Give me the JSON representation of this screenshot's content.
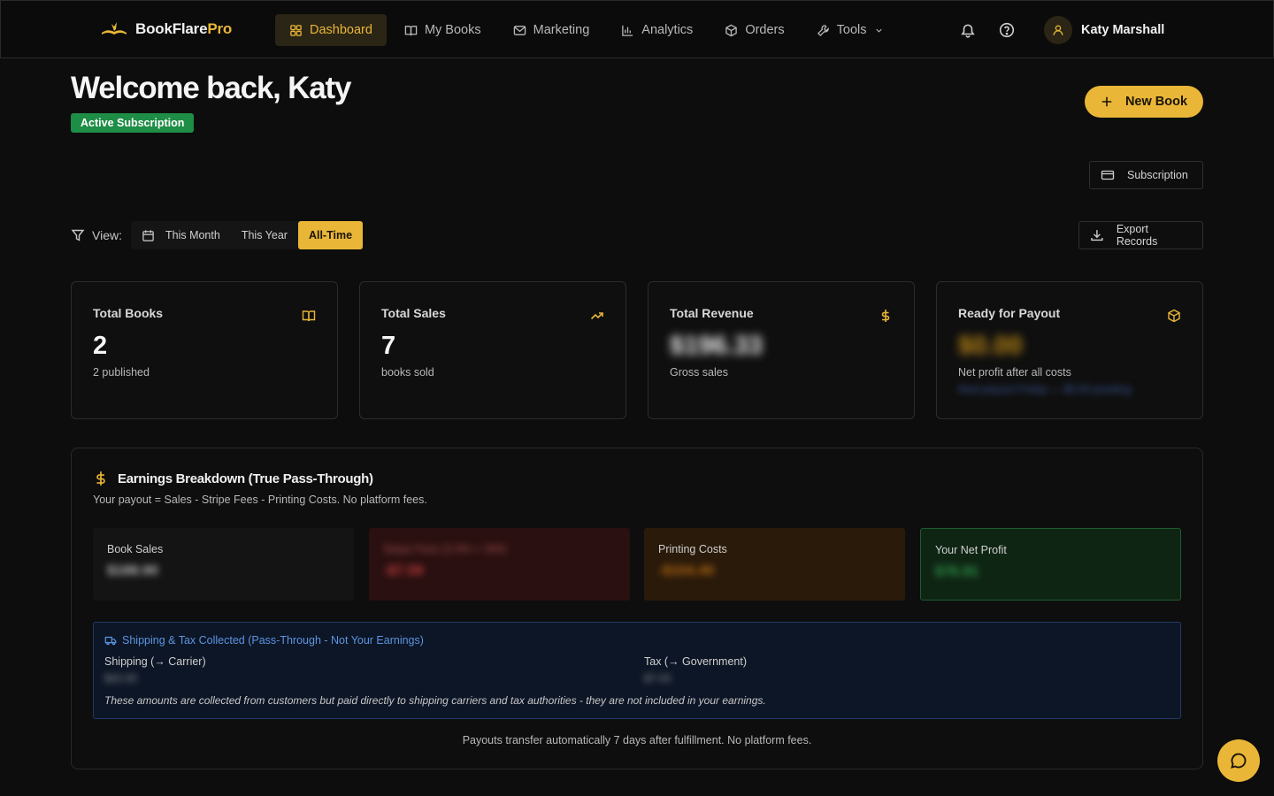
{
  "brand": {
    "name_main": "BookFlare",
    "name_accent": "Pro"
  },
  "nav": {
    "items": [
      {
        "label": "Dashboard",
        "icon": "grid-icon",
        "active": true
      },
      {
        "label": "My Books",
        "icon": "book-open-icon"
      },
      {
        "label": "Marketing",
        "icon": "mail-icon"
      },
      {
        "label": "Analytics",
        "icon": "bar-chart-icon"
      },
      {
        "label": "Orders",
        "icon": "package-icon"
      },
      {
        "label": "Tools",
        "icon": "wrench-icon",
        "has_dropdown": true
      }
    ]
  },
  "user": {
    "name": "Katy Marshall"
  },
  "page": {
    "welcome": "Welcome back, Katy",
    "subscription_badge": "Active Subscription",
    "new_book_label": "New Book",
    "subscription_label": "Subscription",
    "export_label": "Export Records"
  },
  "filter": {
    "label": "View:",
    "options": [
      "This Month",
      "This Year",
      "All-Time"
    ],
    "selected": "All-Time"
  },
  "stats": [
    {
      "title": "Total Books",
      "value": "2",
      "sub": "2 published",
      "icon": "book-open-icon"
    },
    {
      "title": "Total Sales",
      "value": "7",
      "sub": "books sold",
      "icon": "trending-up-icon"
    },
    {
      "title": "Total Revenue",
      "value": "$196.33",
      "sub": "Gross sales",
      "icon": "dollar-icon",
      "blurred": true
    },
    {
      "title": "Ready for Payout",
      "value": "$0.00",
      "sub": "Net profit after all costs",
      "sub2": "Next payout Friday — $0.00 pending",
      "icon": "package-icon",
      "blurred": true
    }
  ],
  "earnings": {
    "title": "Earnings Breakdown (True Pass-Through)",
    "subtitle": "Your payout = Sales - Stripe Fees - Printing Costs. No platform fees.",
    "boxes": [
      {
        "label": "Book Sales",
        "value": "$188.90"
      },
      {
        "label": "Stripe Fees (2.9% + 30¢)",
        "value": "-$7.59"
      },
      {
        "label": "Printing Costs",
        "value": "-$104.40"
      },
      {
        "label": "Your Net Profit",
        "value": "$76.91"
      }
    ],
    "shipping": {
      "title": "Shipping & Tax Collected (Pass-Through - Not Your Earnings)",
      "shipping_label": "Shipping (→ Carrier)",
      "shipping_value": "$42.00",
      "tax_label": "Tax (→ Government)",
      "tax_value": "$7.43",
      "note": "These amounts are collected from customers but paid directly to shipping carriers and tax authorities - they are not included in your earnings."
    },
    "payout_note": "Payouts transfer automatically 7 days after fulfillment. No platform fees."
  },
  "colors": {
    "accent": "#e9b637",
    "success": "#1e8d46",
    "info": "#5b94e0",
    "danger": "#c23b3b"
  }
}
